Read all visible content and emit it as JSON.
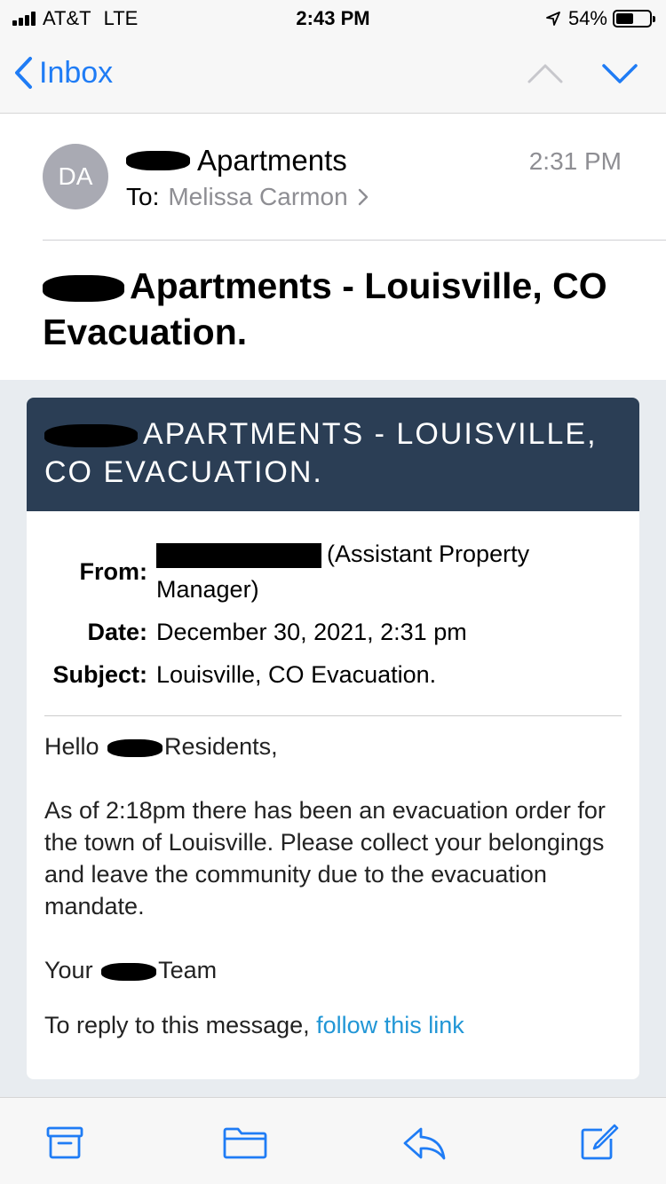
{
  "status_bar": {
    "carrier": "AT&T",
    "network": "LTE",
    "time": "2:43 PM",
    "battery": "54%",
    "battery_level": 0.54
  },
  "nav": {
    "back_label": "Inbox",
    "icons": [
      "chevron-left-icon",
      "chevron-up-icon",
      "chevron-down-icon"
    ]
  },
  "header": {
    "avatar_initials": "DA",
    "sender": "Apartments",
    "received_time": "2:31 PM",
    "to_label": "To:",
    "to_name": "Melissa Carmon",
    "subject": "Apartments - Louisville, CO Evacuation."
  },
  "email": {
    "banner_title": "APARTMENTS - LOUISVILLE, CO EVACUATION.",
    "from_label": "From:",
    "from_value": "(Assistant Property Manager)",
    "date_label": "Date:",
    "date_value": "December 30, 2021, 2:31 pm",
    "subject_label": "Subject:",
    "subject_value": "Louisville, CO Evacuation.",
    "greeting_start": "Hello",
    "greeting_end": "Residents,",
    "paragraph": "As of 2:18pm there has been an evacuation order for the town of Louisville. Please collect your belongings and leave the community due to the evacuation mandate.",
    "signoff_start": "Your",
    "signoff_end": "Team",
    "reply_text": "To reply to this message,",
    "reply_link": "follow this link"
  },
  "colors": {
    "ios_blue": "#1f7cf5",
    "banner_bg": "#2b3e55",
    "link": "#2196d6",
    "body_bg": "#e8ecf0"
  },
  "toolbar": {
    "icons": [
      "archive-icon",
      "folder-icon",
      "reply-icon",
      "compose-icon"
    ]
  }
}
